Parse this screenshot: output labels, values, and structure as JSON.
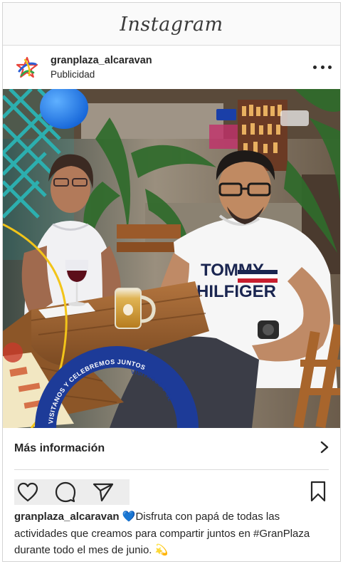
{
  "app": {
    "wordmark": "Instagram"
  },
  "post": {
    "account": "granplaza_alcaravan",
    "sponsored_label": "Publicidad",
    "more_info_label": "Más información",
    "caption": {
      "username": "granplaza_alcaravan",
      "emoji_heart": "💙",
      "text": "Disfruta con papá de todas las actividades que creamos para compartir juntos en #GranPlaza durante todo el mes de junio.",
      "emoji_end": "💫"
    },
    "photo": {
      "shirt_text_line1": "TOMMY",
      "shirt_text_line2": "HILFIGER",
      "placemat_text": "VISITANOS Y CELEBREMOS JUNTOS",
      "placemat_text_2": "VISITANOS Y CE"
    }
  },
  "icons": {
    "avatar": "star-logo-icon",
    "more": "more-horizontal-icon",
    "chevron": "chevron-right-icon",
    "like": "heart-icon",
    "comment": "comment-icon",
    "share": "send-icon",
    "save": "bookmark-icon"
  },
  "colors": {
    "text": "#262626",
    "divider": "#dbdbdb",
    "brand_blue": "#2b5fd6",
    "heart_blue": "#3a8fe8"
  }
}
